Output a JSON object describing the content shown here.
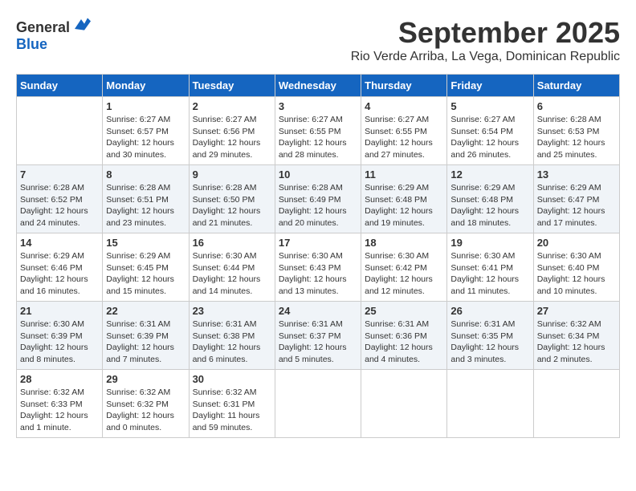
{
  "header": {
    "logo_general": "General",
    "logo_blue": "Blue",
    "month_title": "September 2025",
    "location": "Rio Verde Arriba, La Vega, Dominican Republic"
  },
  "weekdays": [
    "Sunday",
    "Monday",
    "Tuesday",
    "Wednesday",
    "Thursday",
    "Friday",
    "Saturday"
  ],
  "weeks": [
    [
      {
        "day": "",
        "sunrise": "",
        "sunset": "",
        "daylight": ""
      },
      {
        "day": "1",
        "sunrise": "Sunrise: 6:27 AM",
        "sunset": "Sunset: 6:57 PM",
        "daylight": "Daylight: 12 hours and 30 minutes."
      },
      {
        "day": "2",
        "sunrise": "Sunrise: 6:27 AM",
        "sunset": "Sunset: 6:56 PM",
        "daylight": "Daylight: 12 hours and 29 minutes."
      },
      {
        "day": "3",
        "sunrise": "Sunrise: 6:27 AM",
        "sunset": "Sunset: 6:55 PM",
        "daylight": "Daylight: 12 hours and 28 minutes."
      },
      {
        "day": "4",
        "sunrise": "Sunrise: 6:27 AM",
        "sunset": "Sunset: 6:55 PM",
        "daylight": "Daylight: 12 hours and 27 minutes."
      },
      {
        "day": "5",
        "sunrise": "Sunrise: 6:27 AM",
        "sunset": "Sunset: 6:54 PM",
        "daylight": "Daylight: 12 hours and 26 minutes."
      },
      {
        "day": "6",
        "sunrise": "Sunrise: 6:28 AM",
        "sunset": "Sunset: 6:53 PM",
        "daylight": "Daylight: 12 hours and 25 minutes."
      }
    ],
    [
      {
        "day": "7",
        "sunrise": "Sunrise: 6:28 AM",
        "sunset": "Sunset: 6:52 PM",
        "daylight": "Daylight: 12 hours and 24 minutes."
      },
      {
        "day": "8",
        "sunrise": "Sunrise: 6:28 AM",
        "sunset": "Sunset: 6:51 PM",
        "daylight": "Daylight: 12 hours and 23 minutes."
      },
      {
        "day": "9",
        "sunrise": "Sunrise: 6:28 AM",
        "sunset": "Sunset: 6:50 PM",
        "daylight": "Daylight: 12 hours and 21 minutes."
      },
      {
        "day": "10",
        "sunrise": "Sunrise: 6:28 AM",
        "sunset": "Sunset: 6:49 PM",
        "daylight": "Daylight: 12 hours and 20 minutes."
      },
      {
        "day": "11",
        "sunrise": "Sunrise: 6:29 AM",
        "sunset": "Sunset: 6:48 PM",
        "daylight": "Daylight: 12 hours and 19 minutes."
      },
      {
        "day": "12",
        "sunrise": "Sunrise: 6:29 AM",
        "sunset": "Sunset: 6:48 PM",
        "daylight": "Daylight: 12 hours and 18 minutes."
      },
      {
        "day": "13",
        "sunrise": "Sunrise: 6:29 AM",
        "sunset": "Sunset: 6:47 PM",
        "daylight": "Daylight: 12 hours and 17 minutes."
      }
    ],
    [
      {
        "day": "14",
        "sunrise": "Sunrise: 6:29 AM",
        "sunset": "Sunset: 6:46 PM",
        "daylight": "Daylight: 12 hours and 16 minutes."
      },
      {
        "day": "15",
        "sunrise": "Sunrise: 6:29 AM",
        "sunset": "Sunset: 6:45 PM",
        "daylight": "Daylight: 12 hours and 15 minutes."
      },
      {
        "day": "16",
        "sunrise": "Sunrise: 6:30 AM",
        "sunset": "Sunset: 6:44 PM",
        "daylight": "Daylight: 12 hours and 14 minutes."
      },
      {
        "day": "17",
        "sunrise": "Sunrise: 6:30 AM",
        "sunset": "Sunset: 6:43 PM",
        "daylight": "Daylight: 12 hours and 13 minutes."
      },
      {
        "day": "18",
        "sunrise": "Sunrise: 6:30 AM",
        "sunset": "Sunset: 6:42 PM",
        "daylight": "Daylight: 12 hours and 12 minutes."
      },
      {
        "day": "19",
        "sunrise": "Sunrise: 6:30 AM",
        "sunset": "Sunset: 6:41 PM",
        "daylight": "Daylight: 12 hours and 11 minutes."
      },
      {
        "day": "20",
        "sunrise": "Sunrise: 6:30 AM",
        "sunset": "Sunset: 6:40 PM",
        "daylight": "Daylight: 12 hours and 10 minutes."
      }
    ],
    [
      {
        "day": "21",
        "sunrise": "Sunrise: 6:30 AM",
        "sunset": "Sunset: 6:39 PM",
        "daylight": "Daylight: 12 hours and 8 minutes."
      },
      {
        "day": "22",
        "sunrise": "Sunrise: 6:31 AM",
        "sunset": "Sunset: 6:39 PM",
        "daylight": "Daylight: 12 hours and 7 minutes."
      },
      {
        "day": "23",
        "sunrise": "Sunrise: 6:31 AM",
        "sunset": "Sunset: 6:38 PM",
        "daylight": "Daylight: 12 hours and 6 minutes."
      },
      {
        "day": "24",
        "sunrise": "Sunrise: 6:31 AM",
        "sunset": "Sunset: 6:37 PM",
        "daylight": "Daylight: 12 hours and 5 minutes."
      },
      {
        "day": "25",
        "sunrise": "Sunrise: 6:31 AM",
        "sunset": "Sunset: 6:36 PM",
        "daylight": "Daylight: 12 hours and 4 minutes."
      },
      {
        "day": "26",
        "sunrise": "Sunrise: 6:31 AM",
        "sunset": "Sunset: 6:35 PM",
        "daylight": "Daylight: 12 hours and 3 minutes."
      },
      {
        "day": "27",
        "sunrise": "Sunrise: 6:32 AM",
        "sunset": "Sunset: 6:34 PM",
        "daylight": "Daylight: 12 hours and 2 minutes."
      }
    ],
    [
      {
        "day": "28",
        "sunrise": "Sunrise: 6:32 AM",
        "sunset": "Sunset: 6:33 PM",
        "daylight": "Daylight: 12 hours and 1 minute."
      },
      {
        "day": "29",
        "sunrise": "Sunrise: 6:32 AM",
        "sunset": "Sunset: 6:32 PM",
        "daylight": "Daylight: 12 hours and 0 minutes."
      },
      {
        "day": "30",
        "sunrise": "Sunrise: 6:32 AM",
        "sunset": "Sunset: 6:31 PM",
        "daylight": "Daylight: 11 hours and 59 minutes."
      },
      {
        "day": "",
        "sunrise": "",
        "sunset": "",
        "daylight": ""
      },
      {
        "day": "",
        "sunrise": "",
        "sunset": "",
        "daylight": ""
      },
      {
        "day": "",
        "sunrise": "",
        "sunset": "",
        "daylight": ""
      },
      {
        "day": "",
        "sunrise": "",
        "sunset": "",
        "daylight": ""
      }
    ]
  ]
}
